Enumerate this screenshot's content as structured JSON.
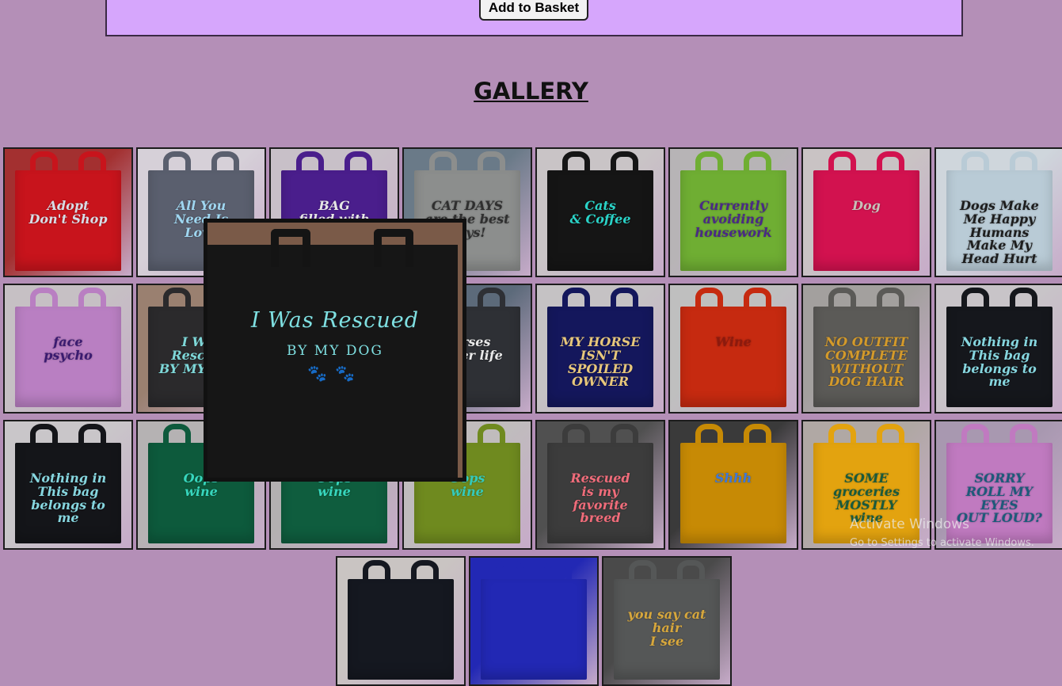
{
  "product": {
    "add_label": "Add to Basket"
  },
  "gallery": {
    "title": "GALLERY",
    "tiles": [
      {
        "text": "Adopt\nDon't Shop",
        "bag": "#c8141c",
        "ink": "#d7dde6",
        "bg": "#a33030"
      },
      {
        "text": "All You\nNeed Is\nLove",
        "bag": "#5a5f6e",
        "ink": "#9fd6f0",
        "bg": "#d6d0d8"
      },
      {
        "text": "BAG\nfilled with\ntoys",
        "bag": "#4a1e8c",
        "ink": "#e6e6e6",
        "bg": "#c8c0c8"
      },
      {
        "text": "CAT DAYS\nare the best days!",
        "bag": "#8c8e8d",
        "ink": "#2f2f2f",
        "bg": "#6a7a88"
      },
      {
        "text": "Cats\n& Coffee",
        "bag": "#151515",
        "ink": "#2ad3c8",
        "bg": "#c9c4c6"
      },
      {
        "text": "Currently\navoiding\nhousework",
        "bag": "#6fae33",
        "ink": "#4a2a86",
        "bg": "#b7b4b6"
      },
      {
        "text": "Dog",
        "bag": "#d2124f",
        "ink": "#c8c0b8",
        "bg": "#c9c3c4"
      },
      {
        "text": "Dogs Make Me Happy\nHumans Make My Head Hurt",
        "bag": "#b9cbd6",
        "ink": "#1d1d1d",
        "bg": "#cfd6dc"
      },
      {
        "text": "face\npsycho",
        "bag": "#b97fc2",
        "ink": "#3a1a70",
        "bg": "#c6c0c4"
      },
      {
        "text": "I Was Rescued\nBY MY DOG",
        "bag": "#2b2a2c",
        "ink": "#7ed7d8",
        "bg": "#9a8070"
      },
      {
        "text": "",
        "bag": "#22242a",
        "ink": "#cccccc",
        "bg": "#8a7a70"
      },
      {
        "text": "horses\nbetter life",
        "bag": "#2e3035",
        "ink": "#e9e9e9",
        "bg": "#5c6a7a"
      },
      {
        "text": "MY HORSE\nISN'T SPOILED\nOWNER",
        "bag": "#14175c",
        "ink": "#e7c77b",
        "bg": "#c5c2c4"
      },
      {
        "text": "Wine",
        "bag": "#c62a10",
        "ink": "#8c1a0e",
        "bg": "#bfbfbf"
      },
      {
        "text": "NO OUTFIT\nCOMPLETE\nWITHOUT\nDOG HAIR",
        "bag": "#5b5a57",
        "ink": "#d49a2a",
        "bg": "#a3a09e"
      },
      {
        "text": "Nothing in\nThis bag\nbelongs to me",
        "bag": "#15171c",
        "ink": "#86d6df",
        "bg": "#c8c4c8"
      },
      {
        "text": "Nothing in\nThis bag\nbelongs to me",
        "bag": "#141519",
        "ink": "#86d6df",
        "bg": "#c9c6c9"
      },
      {
        "text": "Oops\nwine",
        "bag": "#0d5a3c",
        "ink": "#37d6bd",
        "bg": "#b5b2b3"
      },
      {
        "text": "Oops\nwine",
        "bag": "#0f5d3e",
        "ink": "#37d6bd",
        "bg": "#b3b0b1"
      },
      {
        "text": "Oops\nwine",
        "bag": "#6f8a1f",
        "ink": "#34cabb",
        "bg": "#c0bcbd"
      },
      {
        "text": "Rescued\nis my\nfavorite\nbreed",
        "bag": "#3c3c3c",
        "ink": "#f06c7a",
        "bg": "#505050"
      },
      {
        "text": "Shhh",
        "bag": "#c78a05",
        "ink": "#3f78d6",
        "bg": "#3a3a3a"
      },
      {
        "text": "SOME\ngroceries\nMOSTLY\nwine",
        "bag": "#e3a30f",
        "ink": "#1a5a3c",
        "bg": "#b0a8a4"
      },
      {
        "text": "SORRY\nROLL MY\nEYES\nOUT LOUD?",
        "bag": "#c07ac0",
        "ink": "#1d5a7a",
        "bg": "#a898b0"
      },
      {
        "text": "",
        "bag": "#151820",
        "ink": "#dddddd",
        "bg": "#c9c4c2"
      },
      {
        "text": "",
        "bag": "#2228b4",
        "ink": "#e3a736",
        "bg": "#2228b4"
      },
      {
        "text": "you say cat hair\nI see",
        "bag": "#555757",
        "ink": "#d7a73c",
        "bg": "#4a4a4a"
      }
    ]
  },
  "lightbox": {
    "title": "I Was Rescued",
    "subtitle": "BY MY DOG",
    "paws": "🐾🐾"
  },
  "watermark": {
    "title": "Activate Windows",
    "subtitle": "Go to Settings to activate Windows."
  }
}
